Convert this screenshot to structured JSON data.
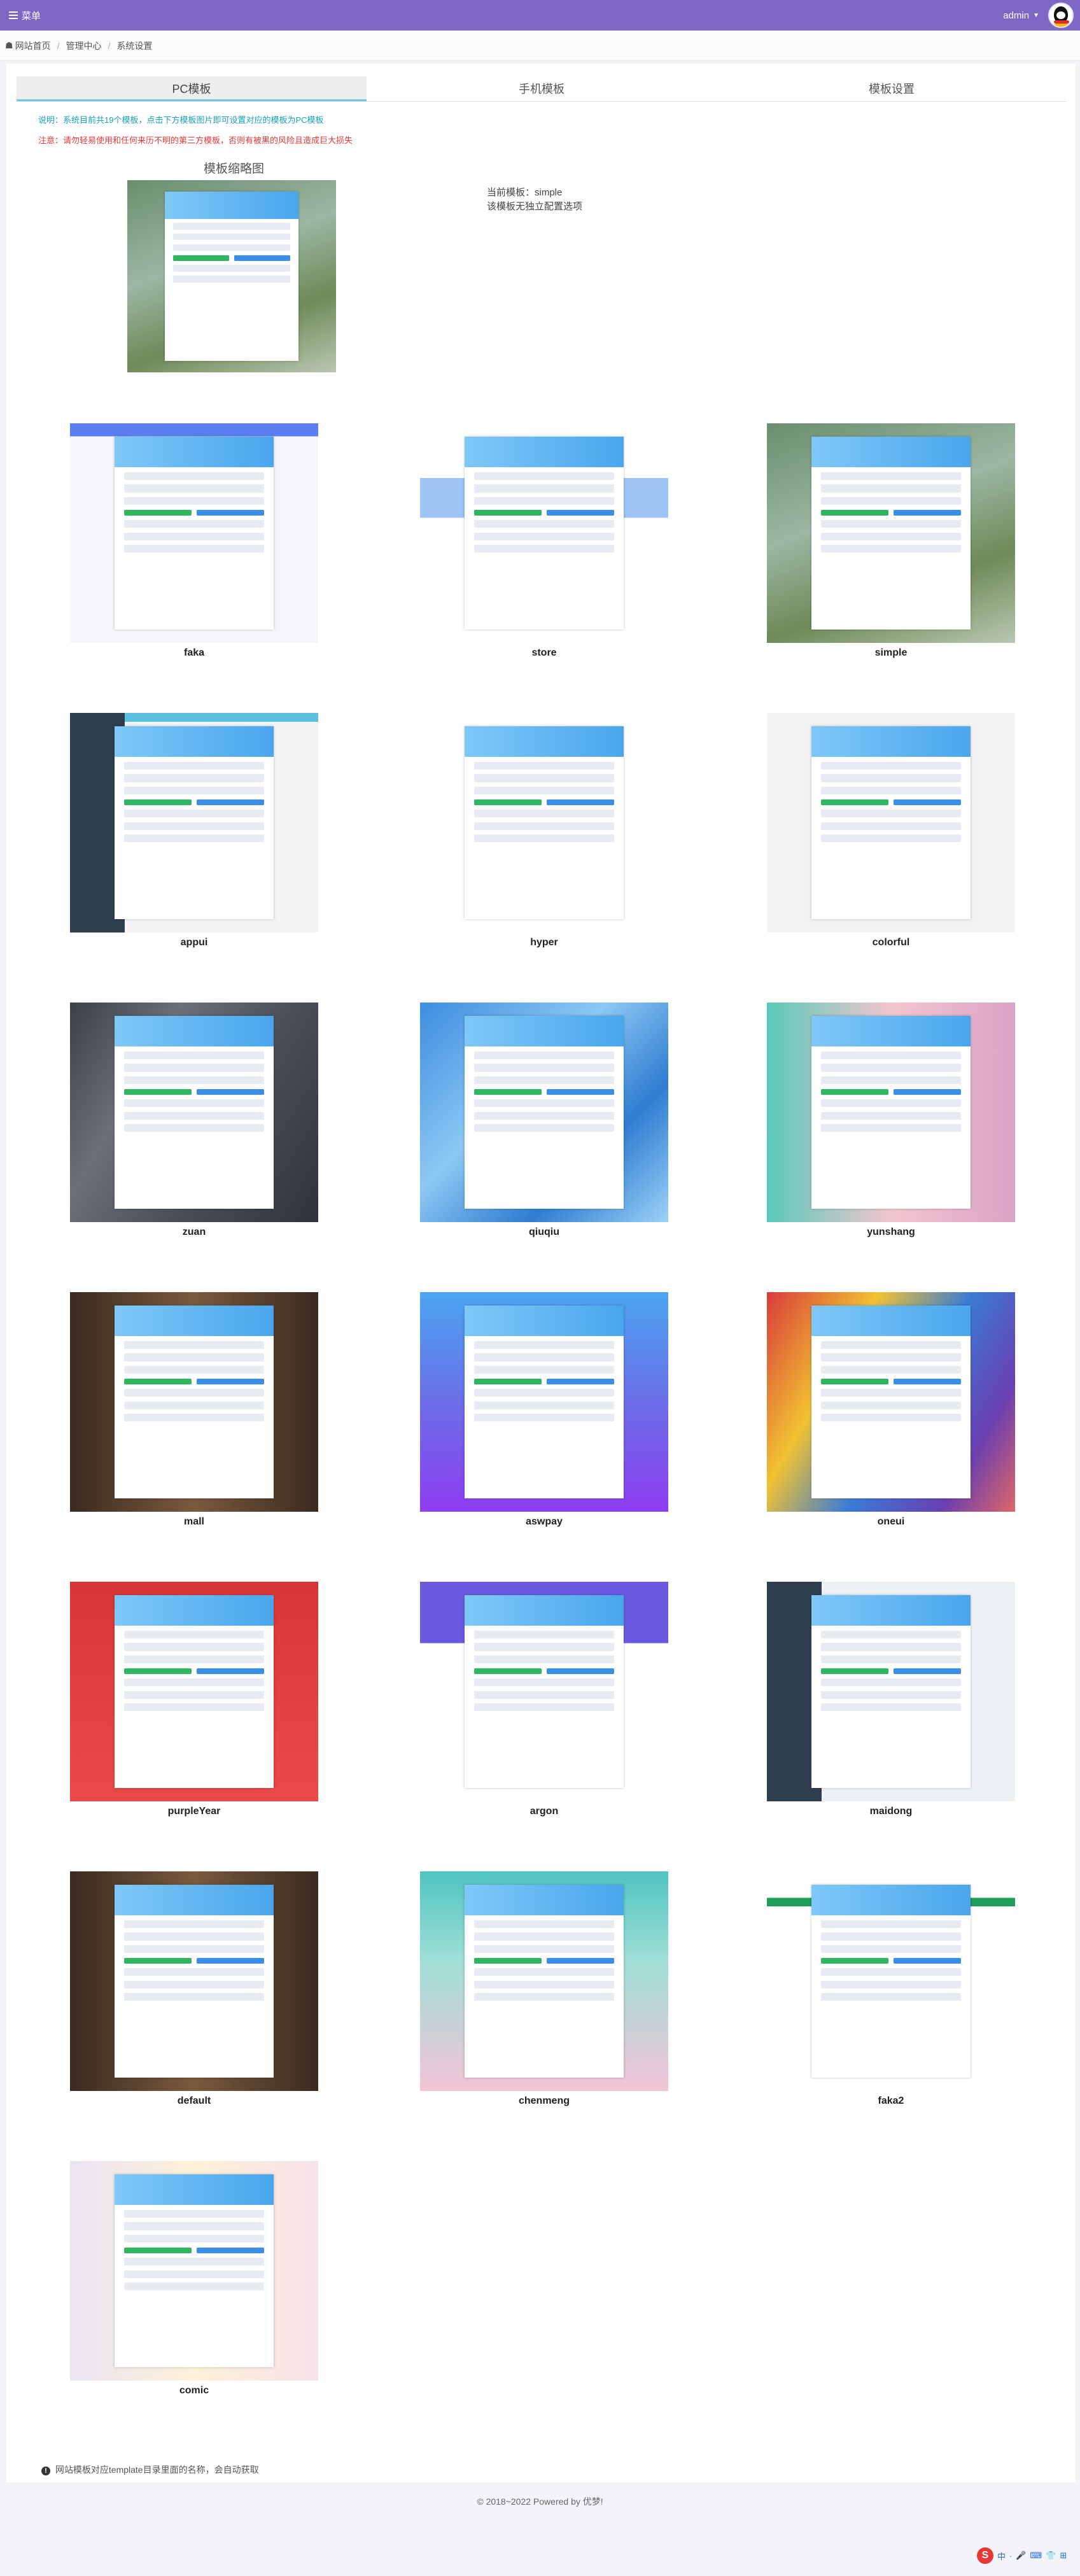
{
  "topbar": {
    "menu_label": "菜单",
    "user_name": "admin"
  },
  "breadcrumb": {
    "items": [
      "网站首页",
      "管理中心",
      "系统设置"
    ]
  },
  "tabs": [
    "PC模板",
    "手机模板",
    "模板设置"
  ],
  "notes": {
    "info": "说明：系统目前共19个模板，点击下方模板图片即可设置对应的模板为PC模板",
    "warning": "注意：请勿轻易使用和任何来历不明的第三方模板，否则有被黑的风险且造成巨大损失"
  },
  "preview": {
    "label": "模板缩略图",
    "current_line": "当前模板：simple",
    "config_line": "该模板无独立配置选项"
  },
  "templates": [
    {
      "name": "faka",
      "style": "faka"
    },
    {
      "name": "store",
      "style": "store"
    },
    {
      "name": "simple",
      "style": "simple"
    },
    {
      "name": "appui",
      "style": "appui"
    },
    {
      "name": "hyper",
      "style": "hyper"
    },
    {
      "name": "colorful",
      "style": "colorful"
    },
    {
      "name": "zuan",
      "style": "zuan"
    },
    {
      "name": "qiuqiu",
      "style": "qiuqiu"
    },
    {
      "name": "yunshang",
      "style": "yunshang"
    },
    {
      "name": "mall",
      "style": "mall"
    },
    {
      "name": "aswpay",
      "style": "aswpay"
    },
    {
      "name": "oneui",
      "style": "oneui"
    },
    {
      "name": "purpleYear",
      "style": "purpleYear"
    },
    {
      "name": "argon",
      "style": "argon"
    },
    {
      "name": "maidong",
      "style": "maidong"
    },
    {
      "name": "default",
      "style": "default"
    },
    {
      "name": "chenmeng",
      "style": "chenmeng"
    },
    {
      "name": "faka2",
      "style": "faka2"
    },
    {
      "name": "comic",
      "style": "comic"
    }
  ],
  "bottom_note": "网站模板对应template目录里面的名称，会自动获取",
  "footer": "© 2018~2022 Powered by 优梦!",
  "ime": {
    "labels": [
      "中",
      "·",
      "🎤",
      "⌨",
      "👕",
      "⊞"
    ]
  },
  "colors": {
    "topbar": "#7e67c4",
    "tab_active_border": "#70c7e8",
    "info": "#17a2b8",
    "warning": "#e53935"
  }
}
